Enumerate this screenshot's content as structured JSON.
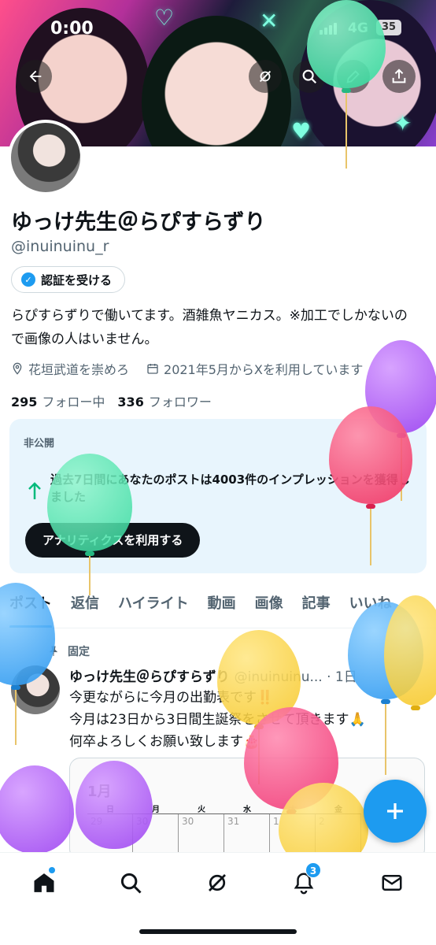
{
  "status_bar": {
    "time": "0:00",
    "network": "4G",
    "battery": "35"
  },
  "profile": {
    "display_name": "ゆっけ先生＠らぴすらずり",
    "handle": "@inuinuinu_r",
    "verify_label": "認証を受ける",
    "bio": "らぴすらずりで働いてます。酒雑魚ヤニカス。※加工でしかないので画像の人はいません。",
    "location": "花垣武道を崇めろ",
    "joined": "2021年5月からXを利用しています",
    "following_count": "295",
    "following_label": "フォロー中",
    "followers_count": "336",
    "followers_label": "フォロワー"
  },
  "analytics_card": {
    "private_label": "非公開",
    "message": "過去7日間にあなたのポストは4003件のインプレッションを獲得しました",
    "cta_label": "アナリティクスを利用する"
  },
  "tabs": [
    "ポスト",
    "返信",
    "ハイライト",
    "動画",
    "画像",
    "記事",
    "いいね"
  ],
  "active_tab": "ポスト",
  "pinned_post": {
    "pinned_label": "固定",
    "author": "ゆっけ先生＠らぴすらずり",
    "handle_time": "@inuinuinu... · 1日",
    "lines": [
      "今更ながらに今月の出勤表です‼️",
      "今月は23日から3日間生誕祭をさせて頂きます🙏",
      "何卒よろしくお願い致します🎂"
    ],
    "calendar": {
      "title": "1月",
      "weekdays": [
        "日",
        "月",
        "火",
        "水",
        "木",
        "金"
      ],
      "first_row": [
        "29",
        "30",
        "30",
        "31",
        "1",
        "2"
      ]
    }
  },
  "bottom_nav": {
    "notification_count": "3"
  },
  "colors": {
    "accent": "#1d9bf0",
    "text": "#0f1419",
    "muted": "#536471",
    "card_bg": "#e8f5fd"
  }
}
